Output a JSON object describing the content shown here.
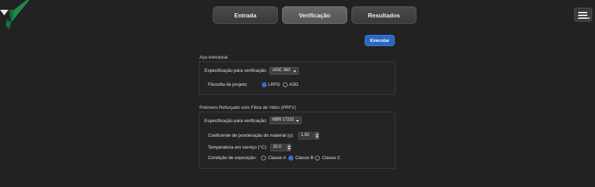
{
  "tabs": [
    {
      "label": "Entrada",
      "active": false
    },
    {
      "label": "Verificação",
      "active": true
    },
    {
      "label": "Resultados",
      "active": false
    }
  ],
  "execute_label": "Executar",
  "steel": {
    "title": "Aço estrutural",
    "spec_label": "Especificação para verificação:",
    "spec_value": "AISC 360",
    "philosophy_label": "Filosofia de projeto:",
    "options": [
      "LRFD",
      "ASD"
    ],
    "selected": "LRFD"
  },
  "gfrp": {
    "title": "Polímero Reforçado com Fibra de Vidro (PRFV)",
    "spec_label": "Especificação para verificação:",
    "spec_value": "NBR 17231",
    "coef_label": "Coeficiente de ponderação do material (γ):",
    "coef_value": "1.50",
    "temp_label": "Temperatura em serviço (°C):",
    "temp_value": "30.0",
    "exposure_label": "Condição de exposição:",
    "exposure_options": [
      "Classe A",
      "Classe B",
      "Classe C"
    ],
    "exposure_selected": "Classe B"
  },
  "colors": {
    "accent": "#2b67c4",
    "background": "#222222",
    "logo_green": "#1f8a4c"
  }
}
